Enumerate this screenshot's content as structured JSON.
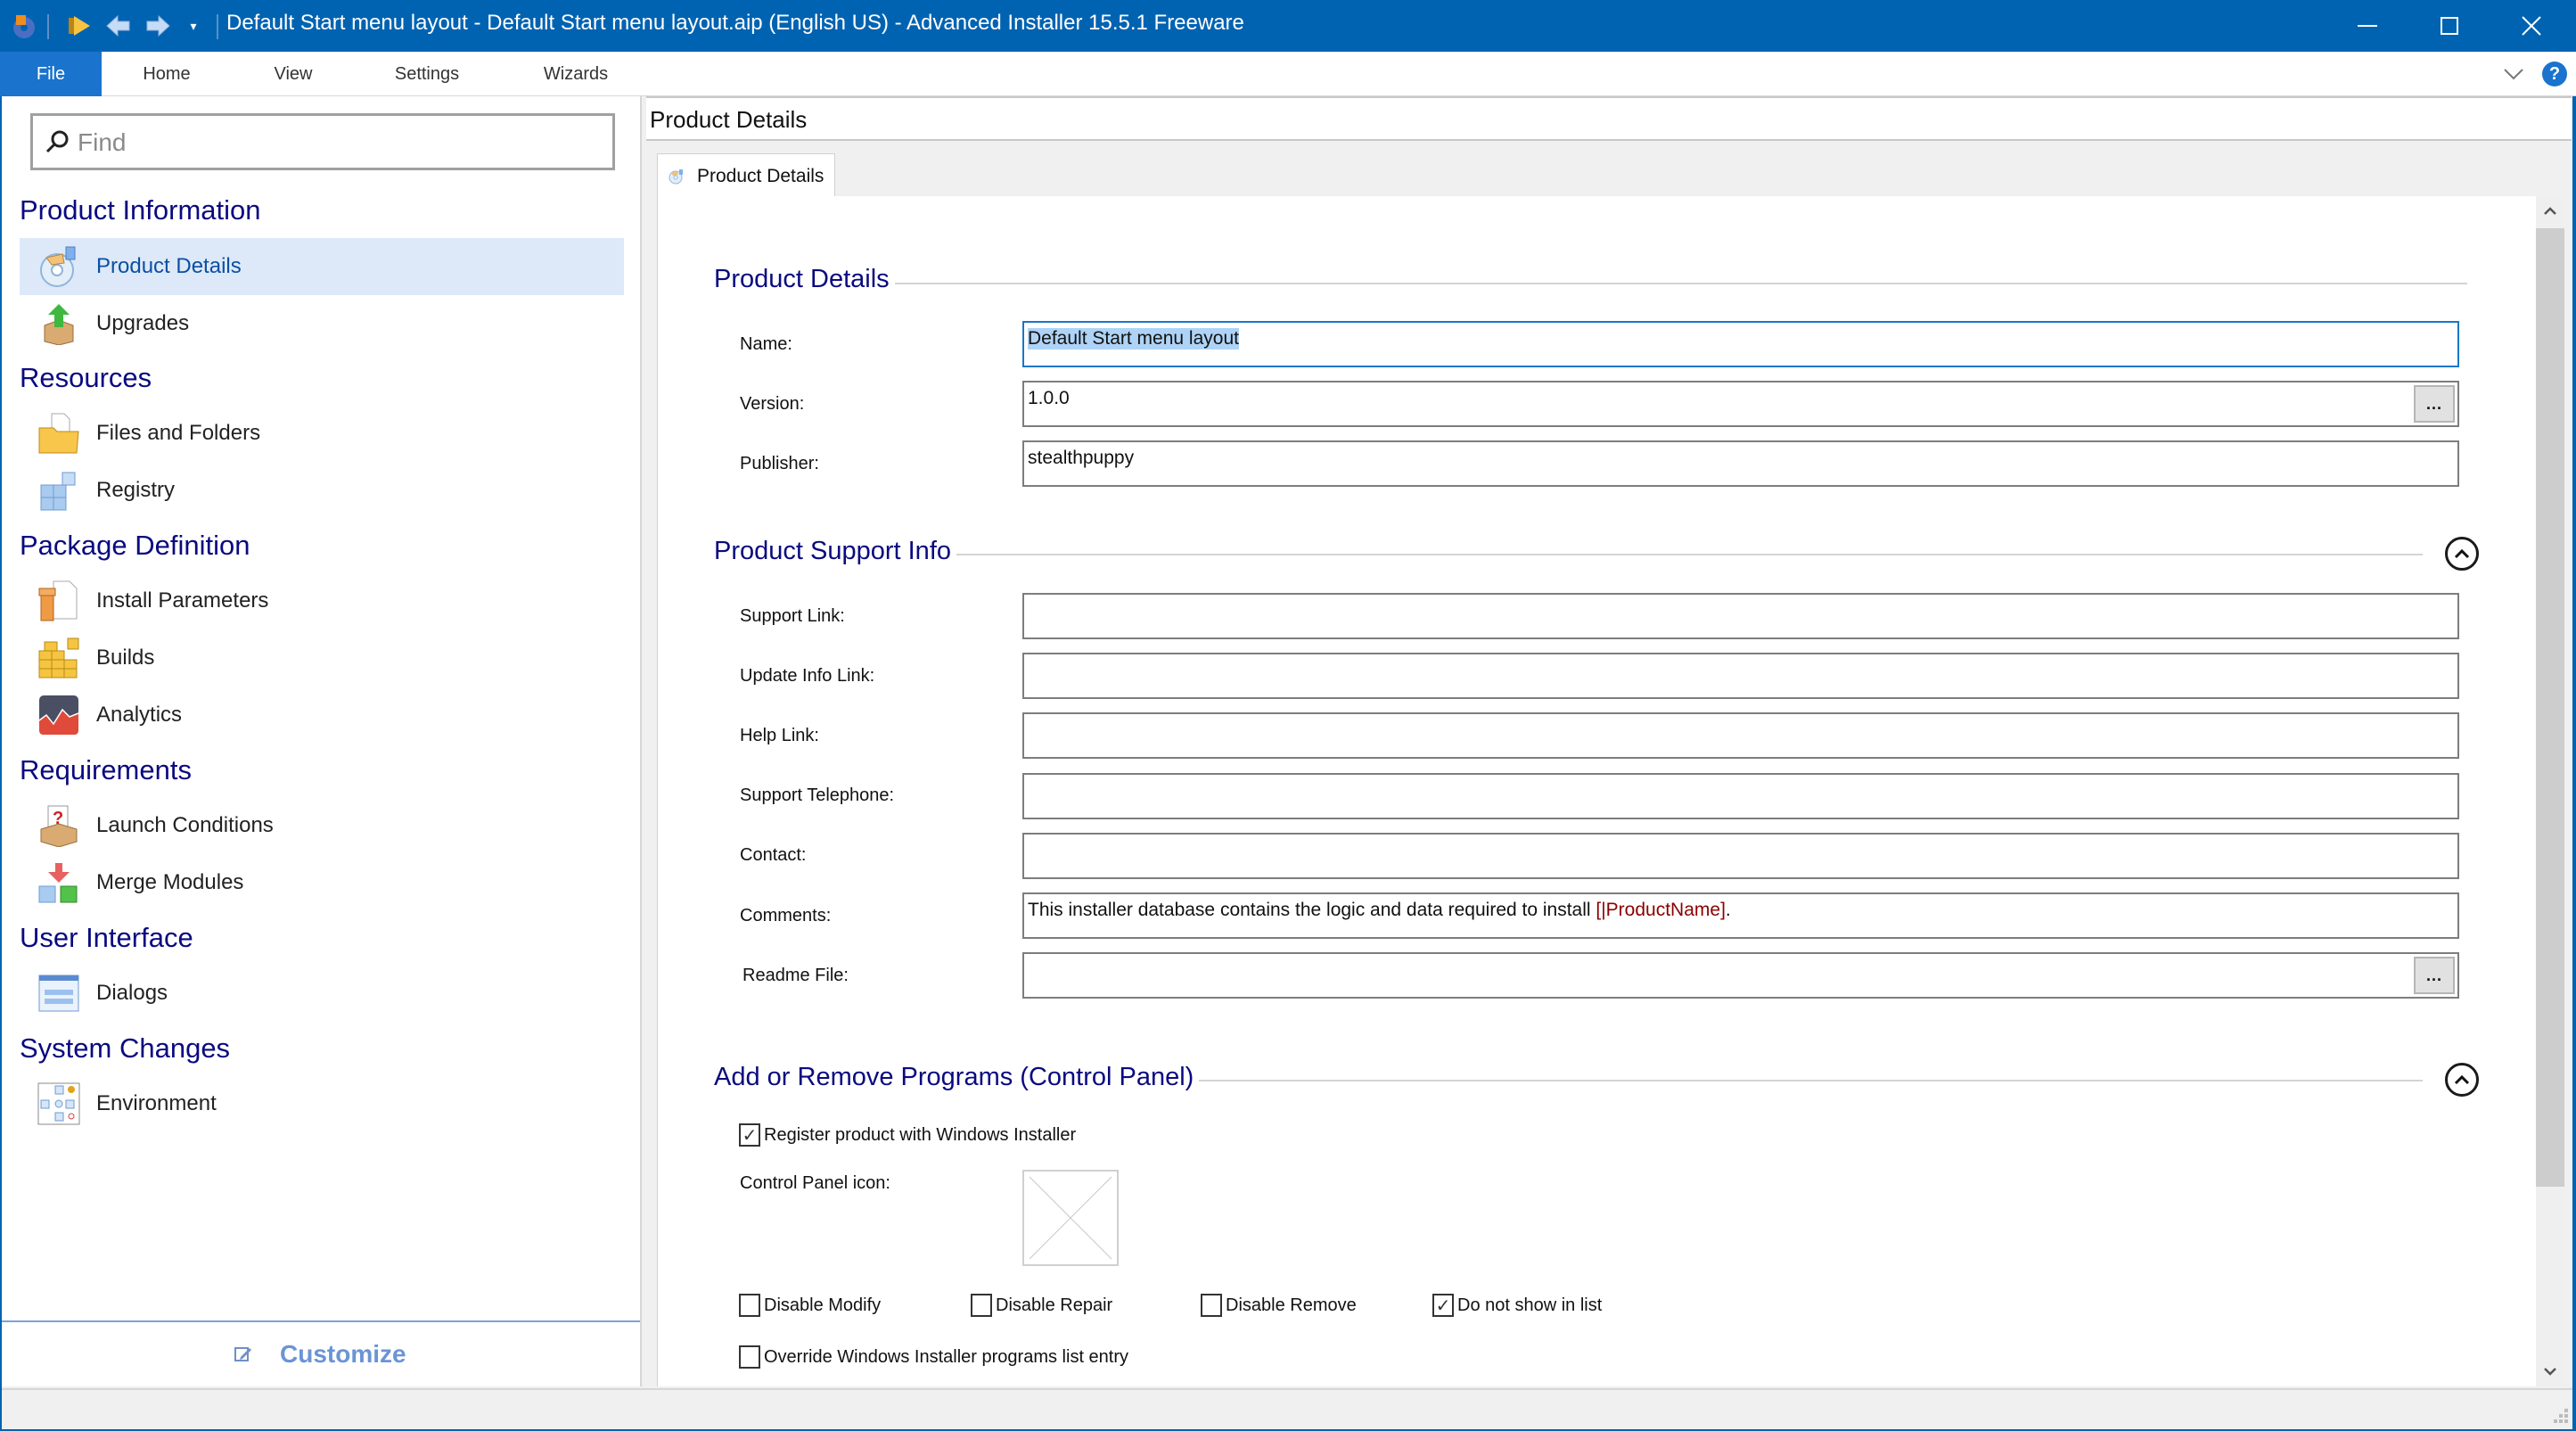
{
  "window": {
    "title": "Default Start menu layout - Default Start menu layout.aip (English US) - Advanced Installer 15.5.1 Freeware",
    "controls": {
      "minimize": "—",
      "maximize": "☐",
      "close": "✕"
    },
    "quick_access": [
      "app-logo",
      "build-run",
      "back",
      "forward",
      "customize-quick-access"
    ]
  },
  "ribbon": {
    "tabs": [
      {
        "label": "File",
        "active": true
      },
      {
        "label": "Home"
      },
      {
        "label": "View"
      },
      {
        "label": "Settings"
      },
      {
        "label": "Wizards"
      }
    ],
    "collapse_glyph": "⌄",
    "help_glyph": "?"
  },
  "sidebar": {
    "search": {
      "placeholder": "Find",
      "value": ""
    },
    "groups": [
      {
        "title": "Product Information",
        "items": [
          {
            "label": "Product Details",
            "icon": "product-details-icon",
            "selected": true
          },
          {
            "label": "Upgrades",
            "icon": "upgrades-icon"
          }
        ]
      },
      {
        "title": "Resources",
        "items": [
          {
            "label": "Files and Folders",
            "icon": "files-folders-icon"
          },
          {
            "label": "Registry",
            "icon": "registry-icon"
          }
        ]
      },
      {
        "title": "Package Definition",
        "items": [
          {
            "label": "Install Parameters",
            "icon": "install-parameters-icon"
          },
          {
            "label": "Builds",
            "icon": "builds-icon"
          },
          {
            "label": "Analytics",
            "icon": "analytics-icon"
          }
        ]
      },
      {
        "title": "Requirements",
        "items": [
          {
            "label": "Launch Conditions",
            "icon": "launch-conditions-icon"
          },
          {
            "label": "Merge Modules",
            "icon": "merge-modules-icon"
          }
        ]
      },
      {
        "title": "User Interface",
        "items": [
          {
            "label": "Dialogs",
            "icon": "dialogs-icon"
          }
        ]
      },
      {
        "title": "System Changes",
        "items": [
          {
            "label": "Environment",
            "icon": "environment-icon"
          }
        ]
      }
    ],
    "customize_label": "Customize"
  },
  "main": {
    "header_title": "Product Details",
    "tab_label": "Product Details",
    "sections": {
      "details": {
        "title": "Product Details",
        "fields": [
          {
            "label": "Name:",
            "value": "Default Start menu layout",
            "focused": true
          },
          {
            "label": "Version:",
            "value": "1.0.0",
            "browse": "..."
          },
          {
            "label": "Publisher:",
            "value": "stealthpuppy"
          }
        ]
      },
      "support": {
        "title": "Product Support Info",
        "fields": [
          {
            "label": "Support Link:",
            "value": ""
          },
          {
            "label": "Update Info Link:",
            "value": ""
          },
          {
            "label": "Help Link:",
            "value": ""
          },
          {
            "label": "Support Telephone:",
            "value": ""
          },
          {
            "label": "Contact:",
            "value": ""
          },
          {
            "label": "Comments:",
            "value_prefix": "This installer database contains the logic and data required to install ",
            "value_token": "[|ProductName]",
            "value_suffix": "."
          },
          {
            "label": "Readme File:",
            "value": "",
            "browse": "..."
          }
        ]
      },
      "arp": {
        "title": "Add or Remove Programs (Control Panel)",
        "register_label": "Register product with Windows Installer",
        "register_checked": true,
        "icon_label": "Control Panel icon:",
        "checkboxes": [
          {
            "label": "Disable Modify",
            "checked": false
          },
          {
            "label": "Disable Repair",
            "checked": false
          },
          {
            "label": "Disable Remove",
            "checked": false
          },
          {
            "label": "Do not show in list",
            "checked": true
          }
        ],
        "override_label": "Override Windows Installer programs list entry",
        "override_checked": false
      }
    },
    "check_glyph": "✓"
  },
  "colors": {
    "titlebar": "#0063b1",
    "accent": "#1a73cc",
    "section_heading": "#0a0a80",
    "selection_bg": "#dde9f8",
    "token": "#8b0000",
    "customize": "#6a94d4"
  }
}
